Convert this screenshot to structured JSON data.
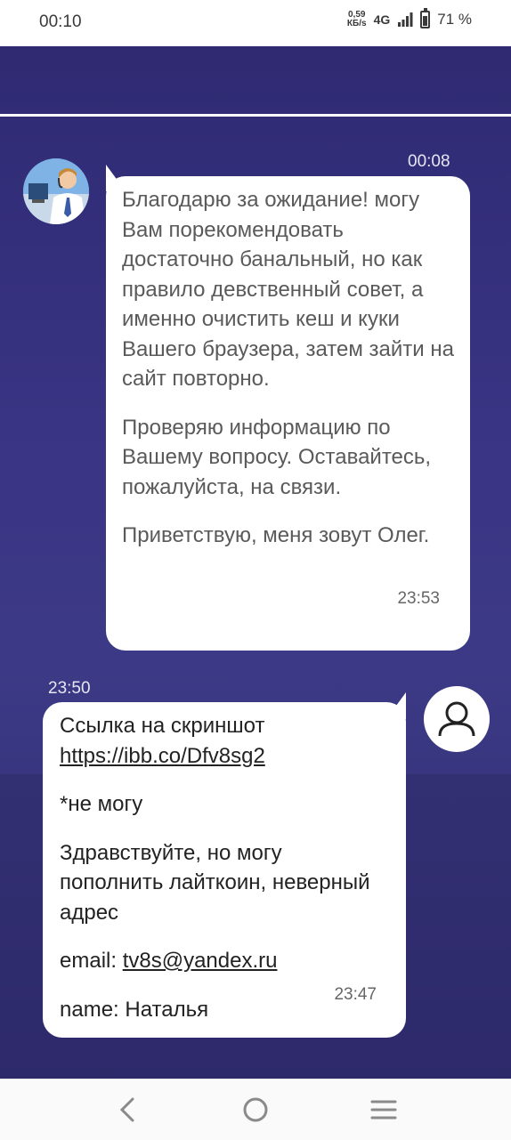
{
  "status_bar": {
    "time": "00:10",
    "speed_value": "0,59",
    "speed_unit": "КБ/s",
    "network": "4G",
    "battery": "71 %"
  },
  "chat": {
    "agent_message": {
      "timestamp": "00:08",
      "paragraphs": [
        "Благодарю за ожидание! могу Вам порекомендовать достаточно банальный, но как правило девственный совет, а именно очистить кеш и куки Вашего браузера, затем зайти на сайт повторно.",
        "Проверяю информацию по Вашему вопросу. Оставайтесь, пожалуйста, на связи.",
        "Приветствую, меня зовут Олег."
      ],
      "time": "23:53"
    },
    "user_message": {
      "timestamp": "23:50",
      "screenshot_label": "Ссылка на скриншот",
      "screenshot_link": "https://ibb.co/Dfv8sg2",
      "line2": "*не могу",
      "line3": "Здравствуйте, но могу пополнить лайткоин, неверный адрес",
      "email_label": "email: ",
      "email_value": "tv8s@yandex.ru",
      "name_line": "name: Наталья",
      "time": "23:47"
    }
  },
  "icons": {
    "back": "back-icon",
    "home": "home-icon",
    "menu": "menu-icon",
    "user": "user-icon",
    "signal": "signal-icon",
    "battery": "battery-icon"
  },
  "colors": {
    "chat_background": "#35307a",
    "bubble": "#ffffff",
    "timestamp": "#e6e6f5"
  }
}
